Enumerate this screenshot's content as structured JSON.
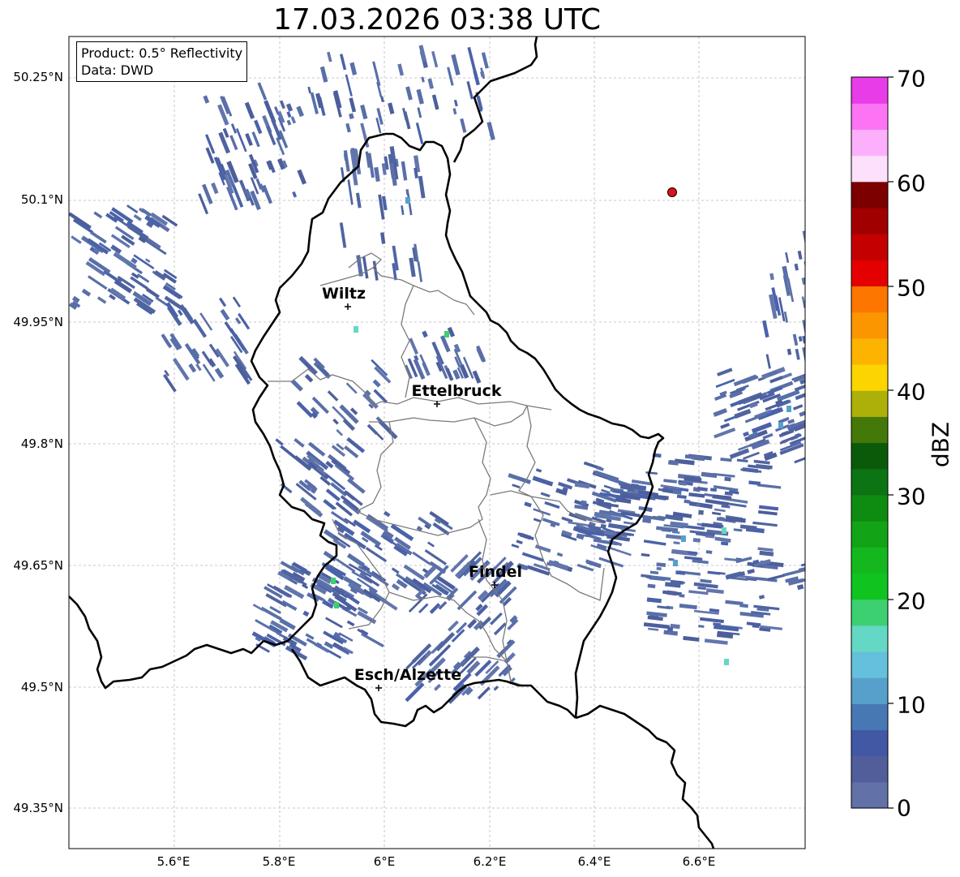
{
  "title": "17.03.2026 03:38 UTC",
  "info": {
    "product": "Product: 0.5° Reflectivity",
    "data_source": "Data: DWD"
  },
  "map": {
    "lon_ticks": [
      "5.6°E",
      "5.8°E",
      "6°E",
      "6.2°E",
      "6.4°E",
      "6.6°E"
    ],
    "lat_ticks": [
      "50.25°N",
      "50.1°N",
      "49.95°N",
      "49.8°N",
      "49.65°N",
      "49.5°N",
      "49.35°N"
    ],
    "extent": {
      "lon_min": 5.4,
      "lon_max": 6.8,
      "lat_min": 49.3,
      "lat_max": 50.3
    },
    "cities": [
      {
        "name": "Wiltz",
        "lon": 5.93,
        "lat": 49.965
      },
      {
        "name": "Ettelbruck",
        "lon": 6.1,
        "lat": 49.85
      },
      {
        "name": "Findel",
        "lon": 6.21,
        "lat": 49.627
      },
      {
        "name": "Esch/Alzette",
        "lon": 5.99,
        "lat": 49.5
      }
    ],
    "radar_site": {
      "lon": 6.548,
      "lat": 50.11,
      "color": "#e0101a"
    }
  },
  "colorbar": {
    "label": "dBZ",
    "ticks": [
      "70",
      "60",
      "50",
      "40",
      "30",
      "20",
      "10",
      "0"
    ],
    "min": 0,
    "max": 70,
    "colors": [
      "#6272a8",
      "#525e9a",
      "#4258a4",
      "#4878b4",
      "#58a0cc",
      "#64c0dc",
      "#64d8c4",
      "#3cd070",
      "#10c420",
      "#14b81e",
      "#12a416",
      "#0e8c12",
      "#0c7412",
      "#0a5a0a",
      "#447808",
      "#acb008",
      "#fcd400",
      "#fcb400",
      "#fc9600",
      "#fc7600",
      "#e40000",
      "#c40000",
      "#a00000",
      "#7c0000",
      "#fce0fc",
      "#fcb0fc",
      "#fc74f4",
      "#e83ce8"
    ]
  }
}
